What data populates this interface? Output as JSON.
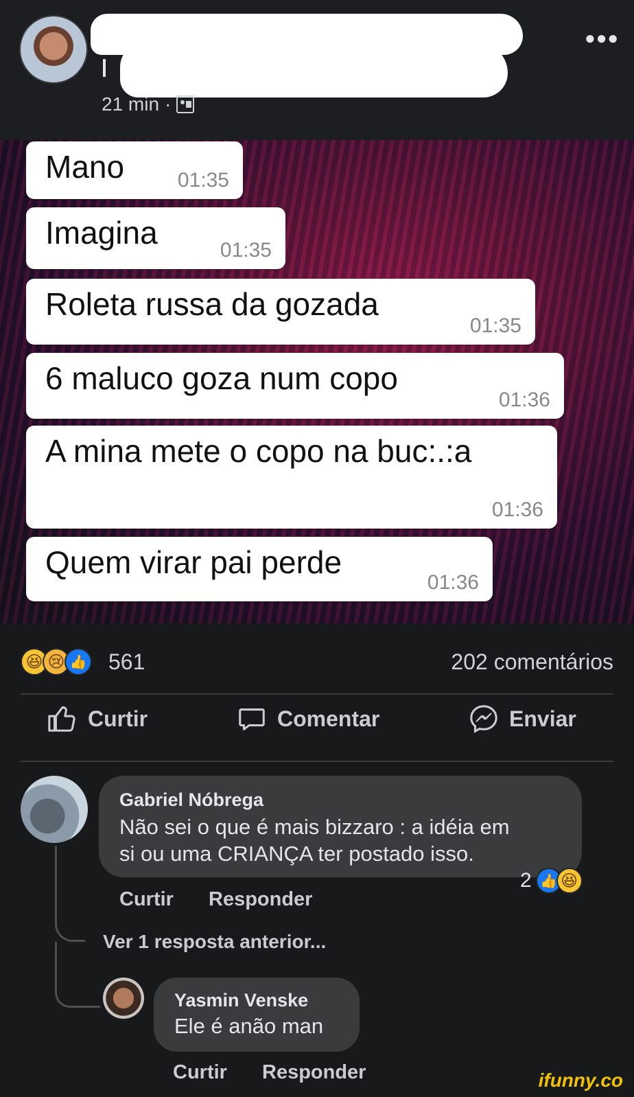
{
  "post": {
    "time": "21 min",
    "separator": "·",
    "audience_icon": "friends-icon",
    "more_icon": "more-options-icon"
  },
  "chat": [
    {
      "text": "Mano",
      "time": "01:35"
    },
    {
      "text": "Imagina",
      "time": "01:35"
    },
    {
      "text": "Roleta russa da gozada",
      "time": "01:35"
    },
    {
      "text": "6 maluco goza num copo",
      "time": "01:36"
    },
    {
      "text": "A mina mete o copo na buc:.:a",
      "time": "01:36"
    },
    {
      "text": "Quem virar pai perde",
      "time": "01:36"
    }
  ],
  "reactions": {
    "count": "561",
    "comments": "202 comentários",
    "icons": [
      "haha-icon",
      "sad-icon",
      "like-icon"
    ]
  },
  "actions": {
    "like": "Curtir",
    "comment": "Comentar",
    "send": "Enviar"
  },
  "comments": [
    {
      "author": "Gabriel Nóbrega",
      "text_line1": "Não sei o que é mais bizzaro : a idéia em",
      "text_line2": "si ou uma CRIANÇA ter postado isso.",
      "like": "Curtir",
      "reply": "Responder",
      "reaction_count": "2"
    }
  ],
  "view_more": "Ver 1 resposta anterior...",
  "reply": {
    "author": "Yasmin Venske",
    "text": "Ele é anão man",
    "like": "Curtir",
    "reply": "Responder"
  },
  "watermark": "ifunny.co",
  "colors": {
    "background": "#18191a",
    "comment_bubble": "#3a3b3c",
    "like_blue": "#1877f2",
    "haha_yellow": "#f7c534"
  }
}
